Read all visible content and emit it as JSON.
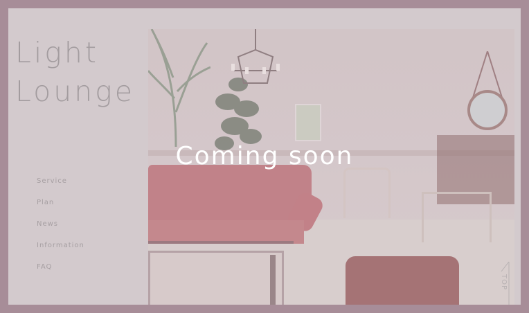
{
  "logo": {
    "line1": "Light",
    "line2": "Lounge"
  },
  "nav": {
    "items": [
      {
        "label": "Service"
      },
      {
        "label": "Plan"
      },
      {
        "label": "News"
      },
      {
        "label": "Information"
      },
      {
        "label": "FAQ"
      }
    ]
  },
  "hero": {
    "overlay_text": "Coming soon"
  },
  "scroll_top": {
    "label": "TOP"
  },
  "colors": {
    "border": "#a8909a",
    "background": "#d7d2d3",
    "text_muted": "#a3a0a1",
    "accent_sofa": "#c48489"
  }
}
